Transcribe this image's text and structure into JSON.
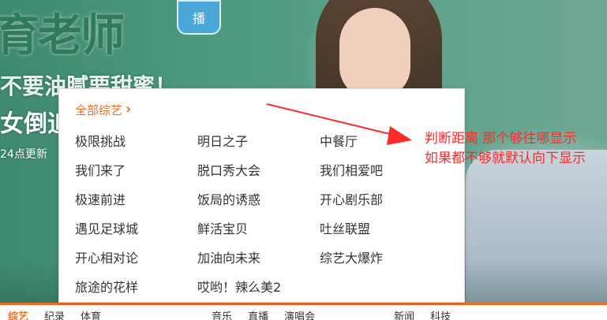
{
  "banner": {
    "title_text": "育老师",
    "badge_text": "播",
    "line1": "不要油腻要甜蜜！",
    "line2": "女倒追男神张嘉译",
    "line3": "24点更新"
  },
  "dropdown": {
    "header_label": "全部综艺",
    "items": [
      "极限挑战",
      "明日之子",
      "中餐厅",
      "我们来了",
      "脱口秀大会",
      "我们相爱吧",
      "极速前进",
      "饭局的诱惑",
      "开心剧乐部",
      "遇见足球城",
      "鲜活宝贝",
      "吐丝联盟",
      "开心相对论",
      "加油向未来",
      "综艺大爆炸",
      "旅途的花样",
      "哎哟！辣么美2"
    ]
  },
  "annotation": {
    "line1": "判断距离 那个够往哪显示",
    "line2": "如果都不够就默认向下显示"
  },
  "bottom_nav": [
    "综艺",
    "纪录",
    "体育",
    "音乐",
    "直播",
    "演唱会",
    "新闻",
    "科技"
  ],
  "colors": {
    "accent": "#f36c21",
    "annotation": "#ff2a2a",
    "text": "#333333"
  }
}
